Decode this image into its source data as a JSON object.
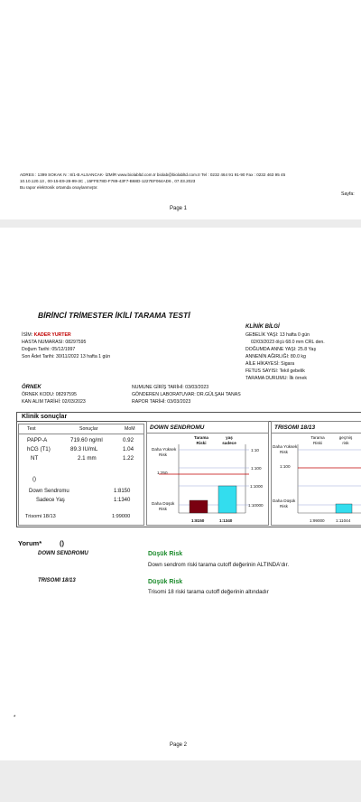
{
  "page1": {
    "address_line1": "ADRES : 1399 SOKAK N : 8/1-B ALSANCAK- İZMİR www.biolabltd.com.tr  biolab@biolabltd.com.tr Tel : 0232 464 91 91-90 Fax : 0232 463 95 45",
    "address_line2": "10.10.120.13 , 00-15-E9-28-99-3C , 15FFE78D-F789-43F7-B68D-1227EF064AD6 , 07.03.2023",
    "address_line3": "Bu rapor elektronik ortamda onaylanmıştır.",
    "sayfa": "Sayfa:",
    "page_number": "Page 1"
  },
  "report": {
    "title": "BİRİNCİ TRİMESTER İKİLİ TARAMA TESTİ",
    "patient": {
      "name_label": "İSİM:",
      "name_value": "KADER YURTER",
      "hasta_no": "HASTA NUMARASI: 08297595",
      "dogum": "Doğum Tarihi: 05/12/1997",
      "son_adet": "Son Âdet Tarihi: 30/11/2022    13 hafta 1 gün"
    },
    "klinik_bilgi": {
      "title": "KLİNİK BİLGİ",
      "lines": [
        "GEBELİK YAŞI: 13 hafta 0 gün",
        "02/03/2023 ölçü 68.0 mm CRL den.",
        "DOĞUMDA ANNE YAŞI: 25.8 Yaş",
        "ANNENİN AĞIRLIĞI: 80.0 kg",
        "AİLE HİKAYESİ:  Sigara",
        "FETUS SAYISI: Tekil gebelik",
        "TARAMA DURUMU:  İlk örnek"
      ]
    },
    "ornek": {
      "title": "ÖRNEK",
      "kod": "ÖRNEK KODU: 08297595",
      "kan_alim": "KAN ALIM TARİHİ: 02/03/2023",
      "numune": "NUMUNE GİRİŞ TARİHİ: 03/03/2023",
      "laboratuvar": "GÖNDEREN LABORATUVAR: DR.GÜLŞAH TANAS",
      "rapor": "RAPOR TARİHİ: 03/03/2023"
    },
    "klinik_sonuclar": {
      "title": "Klinik  sonuçlar",
      "headers": [
        "Test",
        "Sonuçlar",
        "MoM"
      ],
      "rows": [
        {
          "test": "PAPP-A",
          "result": "719.60 ng/ml",
          "mom": "0.92"
        },
        {
          "test": "hCG (T1)",
          "result": "89.3 IU/mL",
          "mom": "1.04"
        },
        {
          "test": "NT",
          "result": "2.1 mm",
          "mom": "1.22"
        }
      ],
      "parens": "()",
      "down_label": "Down Sendromu",
      "down_value": "1:8150",
      "sadece_label": "Sadece Yaş",
      "sadece_value": "1:1340",
      "trisomi_label": "Trisomi 18/13",
      "trisomi_value": "1:99000"
    },
    "down_panel": {
      "title": "DOWN SENDROMU",
      "col1": [
        "Tarama",
        "Riski"
      ],
      "col2": [
        "yaş",
        "sadece"
      ],
      "high_label": [
        "Daha Yüksek",
        "Risk"
      ],
      "low_label": [
        "Daha Düşük",
        "Risk"
      ],
      "scale_1_10": "1:10",
      "scale_1_100": "1:100",
      "scale_1_250": "1:250",
      "scale_1_1000": "1:1000",
      "scale_1_10000": "1:10000",
      "bar1_label": "1:8150",
      "bar2_label": "1:1340",
      "bar1_color": "#7a0010",
      "bar2_color": "#33ddee"
    },
    "trisomi_panel": {
      "title": "TRISOMI 18/13",
      "col1": [
        "Tarama",
        "Riski"
      ],
      "col2": [
        "geçmiş",
        "risk"
      ],
      "high_label": [
        "Daha Yüksek",
        "Risk"
      ],
      "low_label": [
        "Daha Düşük",
        "Risk"
      ],
      "scale_1_100": "1:100",
      "bar1_label": "1:99000",
      "bar2_label": "1:11044",
      "bar2_color": "#33ddee"
    },
    "yorum": {
      "title": "Yorum*",
      "parens": "()",
      "items": [
        {
          "label": "DOWN SENDROMU",
          "risk": "Düşük Risk",
          "text": "Down sendrom riski tarama cutoff değerinin ALTINDA'dır."
        },
        {
          "label": "TRISOMI 18/13",
          "risk": "Düşük Risk",
          "text": "Trisomi 18 riski tarama cutoff değerinin altındadır"
        }
      ]
    },
    "footnote": "*",
    "page_number": "Page 2"
  }
}
